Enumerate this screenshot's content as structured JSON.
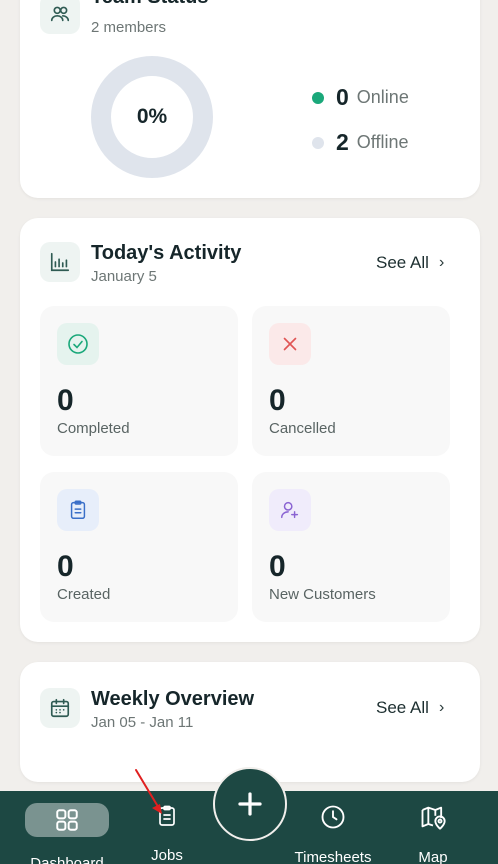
{
  "team_status": {
    "title": "Team Status",
    "subtitle": "2 members",
    "percent": "0%",
    "online_count": "0",
    "online_label": "Online",
    "offline_count": "2",
    "offline_label": "Offline",
    "colors": {
      "online": "#1aa87a",
      "offline": "#dfe4ec"
    }
  },
  "activity": {
    "title": "Today's Activity",
    "date": "January 5",
    "see_all": "See All",
    "tiles": [
      {
        "value": "0",
        "label": "Completed",
        "icon": "check-circle-icon"
      },
      {
        "value": "0",
        "label": "Cancelled",
        "icon": "x-icon"
      },
      {
        "value": "0",
        "label": "Created",
        "icon": "clipboard-icon"
      },
      {
        "value": "0",
        "label": "New Customers",
        "icon": "user-plus-icon"
      }
    ]
  },
  "weekly": {
    "title": "Weekly Overview",
    "range": "Jan 05 - Jan 11",
    "see_all": "See All"
  },
  "nav": {
    "items": [
      {
        "label": "Dashboard",
        "icon": "grid-icon",
        "active": true
      },
      {
        "label": "Jobs",
        "icon": "clipboard-icon"
      },
      {
        "label": "Timesheets",
        "icon": "clock-icon"
      },
      {
        "label": "Map",
        "icon": "map-pin-icon"
      }
    ],
    "fab_icon": "plus-icon"
  },
  "accent_color": "#1d4843"
}
